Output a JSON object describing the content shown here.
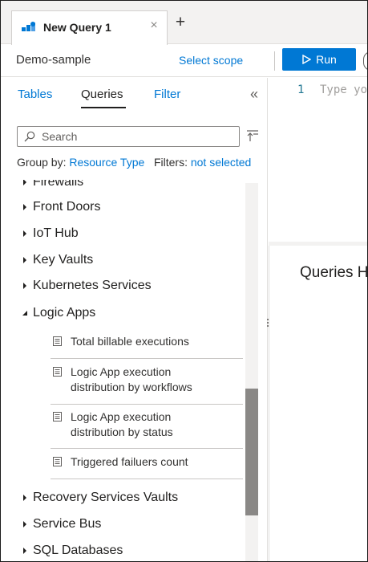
{
  "tabs": [
    {
      "label": "New Query 1",
      "close": "×"
    }
  ],
  "tab_add": "+",
  "toolbar": {
    "scope_name": "Demo-sample",
    "select_scope": "Select scope",
    "run_label": "Run"
  },
  "panel": {
    "tabs": [
      "Tables",
      "Queries",
      "Filter"
    ],
    "active_tab": "Queries",
    "collapse": "«",
    "search_placeholder": "Search",
    "group_by_label": "Group by:",
    "group_by_value": "Resource Type",
    "filters_label": "Filters:",
    "filters_value": "not selected"
  },
  "categories": [
    {
      "label": "Firewalls",
      "expanded": false
    },
    {
      "label": "Front Doors",
      "expanded": false
    },
    {
      "label": "IoT Hub",
      "expanded": false
    },
    {
      "label": "Key Vaults",
      "expanded": false
    },
    {
      "label": "Kubernetes Services",
      "expanded": false
    },
    {
      "label": "Logic Apps",
      "expanded": true
    },
    {
      "label": "Recovery Services Vaults",
      "expanded": false
    },
    {
      "label": "Service Bus",
      "expanded": false
    },
    {
      "label": "SQL Databases",
      "expanded": false
    }
  ],
  "logic_app_queries": [
    {
      "line1": "Total billable executions",
      "line2": ""
    },
    {
      "line1": "Logic App execution",
      "line2": "distribution by workflows"
    },
    {
      "line1": "Logic App execution",
      "line2": "distribution by status"
    },
    {
      "line1": "Triggered failuers count",
      "line2": ""
    }
  ],
  "editor": {
    "line_number": "1",
    "placeholder": "Type your query here..."
  },
  "results": {
    "title": "Queries Hub"
  },
  "colors": {
    "accent": "#0078d4",
    "run_button": "#0078d4",
    "scroll_thumb": "#8a8886"
  },
  "icons": {
    "tab": "query-icon",
    "run": "play-icon",
    "search": "search-icon",
    "sort": "sort-icon",
    "category": "caret-icon",
    "query": "document-icon"
  }
}
